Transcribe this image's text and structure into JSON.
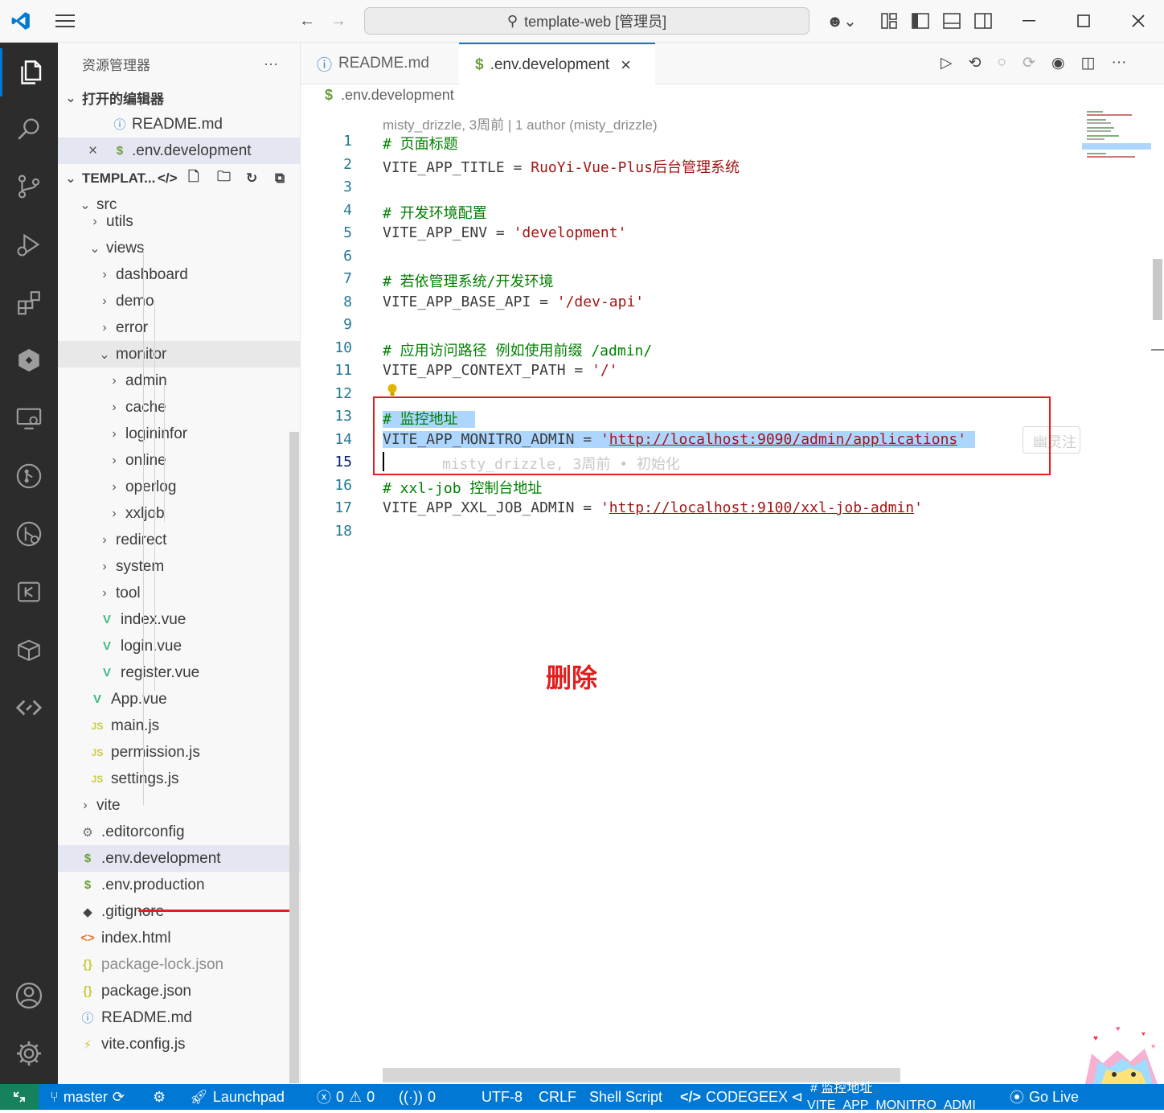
{
  "titlebar": {
    "title": "template-web [管理员]",
    "icons": [
      "vscode-logo-icon",
      "menu-icon",
      "back-arrow-icon",
      "forward-arrow-icon",
      "search-icon",
      "copilot-icon",
      "customize-layout-icon",
      "toggle-sidebar-icon",
      "toggle-panel-icon",
      "toggle-secondary-sidebar-icon",
      "minimize-icon",
      "maximize-icon",
      "close-icon"
    ]
  },
  "activity_bar": {
    "items": [
      "explorer-icon",
      "search-icon",
      "source-control-icon",
      "run-debug-icon",
      "extensions-icon",
      "codegeex-icon",
      "remote-explorer-icon",
      "gitlens-icon",
      "git-graph-icon",
      "kimi-icon",
      "docker-icon",
      "codegeex-code-icon",
      "accounts-icon",
      "settings-gear-icon"
    ]
  },
  "sidebar": {
    "title": "资源管理器",
    "more": "···",
    "open_editors_label": "打开的编辑器",
    "open_editors": [
      {
        "icon": "ⓘ",
        "name": "README.md"
      },
      {
        "icon": "$",
        "name": ".env.development",
        "close": "×"
      }
    ],
    "project_label": "TEMPLAT...",
    "tree": [
      {
        "name": "src",
        "indent": 1,
        "chev": "⌄",
        "kind": "folder"
      },
      {
        "name": "utils",
        "indent": 2,
        "chev": "›",
        "kind": "folder"
      },
      {
        "name": "views",
        "indent": 2,
        "chev": "⌄",
        "kind": "folder"
      },
      {
        "name": "dashboard",
        "indent": 3,
        "chev": "›",
        "kind": "folder"
      },
      {
        "name": "demo",
        "indent": 3,
        "chev": "›",
        "kind": "folder"
      },
      {
        "name": "error",
        "indent": 3,
        "chev": "›",
        "kind": "folder"
      },
      {
        "name": "monitor",
        "indent": 3,
        "chev": "⌄",
        "kind": "folder"
      },
      {
        "name": "admin",
        "indent": 4,
        "chev": "›",
        "kind": "folder"
      },
      {
        "name": "cache",
        "indent": 4,
        "chev": "›",
        "kind": "folder"
      },
      {
        "name": "logininfor",
        "indent": 4,
        "chev": "›",
        "kind": "folder"
      },
      {
        "name": "online",
        "indent": 4,
        "chev": "›",
        "kind": "folder"
      },
      {
        "name": "operlog",
        "indent": 4,
        "chev": "›",
        "kind": "folder"
      },
      {
        "name": "xxljob",
        "indent": 4,
        "chev": "›",
        "kind": "folder"
      },
      {
        "name": "redirect",
        "indent": 3,
        "chev": "›",
        "kind": "folder"
      },
      {
        "name": "system",
        "indent": 3,
        "chev": "›",
        "kind": "folder"
      },
      {
        "name": "tool",
        "indent": 3,
        "chev": "›",
        "kind": "folder"
      },
      {
        "name": "index.vue",
        "indent": 3,
        "chev": "",
        "kind": "vue"
      },
      {
        "name": "login.vue",
        "indent": 3,
        "chev": "",
        "kind": "vue"
      },
      {
        "name": "register.vue",
        "indent": 3,
        "chev": "",
        "kind": "vue"
      },
      {
        "name": "App.vue",
        "indent": 2,
        "chev": "",
        "kind": "vue"
      },
      {
        "name": "main.js",
        "indent": 2,
        "chev": "",
        "kind": "js"
      },
      {
        "name": "permission.js",
        "indent": 2,
        "chev": "",
        "kind": "js"
      },
      {
        "name": "settings.js",
        "indent": 2,
        "chev": "",
        "kind": "js"
      },
      {
        "name": "vite",
        "indent": 1,
        "chev": "›",
        "kind": "folder"
      },
      {
        "name": ".editorconfig",
        "indent": 1,
        "chev": "",
        "kind": "gear"
      },
      {
        "name": ".env.development",
        "indent": 1,
        "chev": "",
        "kind": "env"
      },
      {
        "name": ".env.production",
        "indent": 1,
        "chev": "",
        "kind": "env"
      },
      {
        "name": ".gitignore",
        "indent": 1,
        "chev": "",
        "kind": "git"
      },
      {
        "name": "index.html",
        "indent": 1,
        "chev": "",
        "kind": "html"
      },
      {
        "name": "package-lock.json",
        "indent": 1,
        "chev": "",
        "kind": "json"
      },
      {
        "name": "package.json",
        "indent": 1,
        "chev": "",
        "kind": "json"
      },
      {
        "name": "README.md",
        "indent": 1,
        "chev": "",
        "kind": "info"
      },
      {
        "name": "vite.config.js",
        "indent": 1,
        "chev": "",
        "kind": "vite"
      }
    ]
  },
  "tabs": [
    {
      "label": "README.md",
      "icon": "ⓘ"
    },
    {
      "label": ".env.development",
      "icon": "$",
      "close": "×"
    }
  ],
  "breadcrumb": ".env.development",
  "blame_header": "misty_drizzle, 3周前 | 1 author (misty_drizzle)",
  "code_lines": [
    {
      "n": "1",
      "parts": [
        {
          "t": "# 页面标题",
          "c": "cm"
        }
      ]
    },
    {
      "n": "2",
      "parts": [
        {
          "t": "VITE_APP_TITLE = ",
          "c": ""
        },
        {
          "t": "RuoYi-Vue-Plus后台管理系统",
          "c": "str"
        }
      ]
    },
    {
      "n": "3",
      "parts": []
    },
    {
      "n": "4",
      "parts": [
        {
          "t": "# 开发环境配置",
          "c": "cm"
        }
      ]
    },
    {
      "n": "5",
      "parts": [
        {
          "t": "VITE_APP_ENV = ",
          "c": ""
        },
        {
          "t": "'development'",
          "c": "str"
        }
      ]
    },
    {
      "n": "6",
      "parts": []
    },
    {
      "n": "7",
      "parts": [
        {
          "t": "# 若依管理系统/开发环境",
          "c": "cm"
        }
      ]
    },
    {
      "n": "8",
      "parts": [
        {
          "t": "VITE_APP_BASE_API = ",
          "c": ""
        },
        {
          "t": "'/dev-api'",
          "c": "str"
        }
      ]
    },
    {
      "n": "9",
      "parts": []
    },
    {
      "n": "10",
      "parts": [
        {
          "t": "# 应用访问路径 例如使用前缀 /admin/",
          "c": "cm"
        }
      ]
    },
    {
      "n": "11",
      "parts": [
        {
          "t": "VITE_APP_CONTEXT_PATH = ",
          "c": ""
        },
        {
          "t": "'/'",
          "c": "str"
        }
      ]
    },
    {
      "n": "12",
      "parts": []
    },
    {
      "n": "13",
      "parts": [
        {
          "t": "# 监控地址",
          "c": "cm sel"
        }
      ]
    },
    {
      "n": "14",
      "parts": [
        {
          "t": "VITE_APP_MONITRO_ADMIN = ",
          "c": "sel"
        },
        {
          "t": "'",
          "c": "str sel"
        },
        {
          "t": "http://localhost:9090/admin/applications",
          "c": "url sel"
        },
        {
          "t": "'",
          "c": "str sel"
        }
      ]
    },
    {
      "n": "15",
      "parts": []
    },
    {
      "n": "16",
      "parts": [
        {
          "t": "# xxl-job 控制台地址",
          "c": "cm"
        }
      ]
    },
    {
      "n": "17",
      "parts": [
        {
          "t": "VITE_APP_XXL_JOB_ADMIN = ",
          "c": ""
        },
        {
          "t": "'",
          "c": "str"
        },
        {
          "t": "http://localhost:9100/xxl-job-admin",
          "c": "url"
        },
        {
          "t": "'",
          "c": "str"
        }
      ]
    },
    {
      "n": "18",
      "parts": []
    }
  ],
  "inline_blame": "misty_drizzle, 3周前 • 初始化",
  "inline_hint": "幽灵注",
  "annotation": {
    "label": "删除",
    "color": "#e31d1d"
  },
  "statusbar": {
    "branch": "master",
    "launchpad": "Launchpad",
    "errors": "0",
    "warnings": "0",
    "ports": "0",
    "encoding": "UTF-8",
    "eol": "CRLF",
    "language": "Shell Script",
    "codegeex": "CODEGEEX",
    "overlay_line1": "# 监控地址",
    "overlay_line2": "VITE_APP_MONITRO_ADMI",
    "golive": "Go Live"
  }
}
